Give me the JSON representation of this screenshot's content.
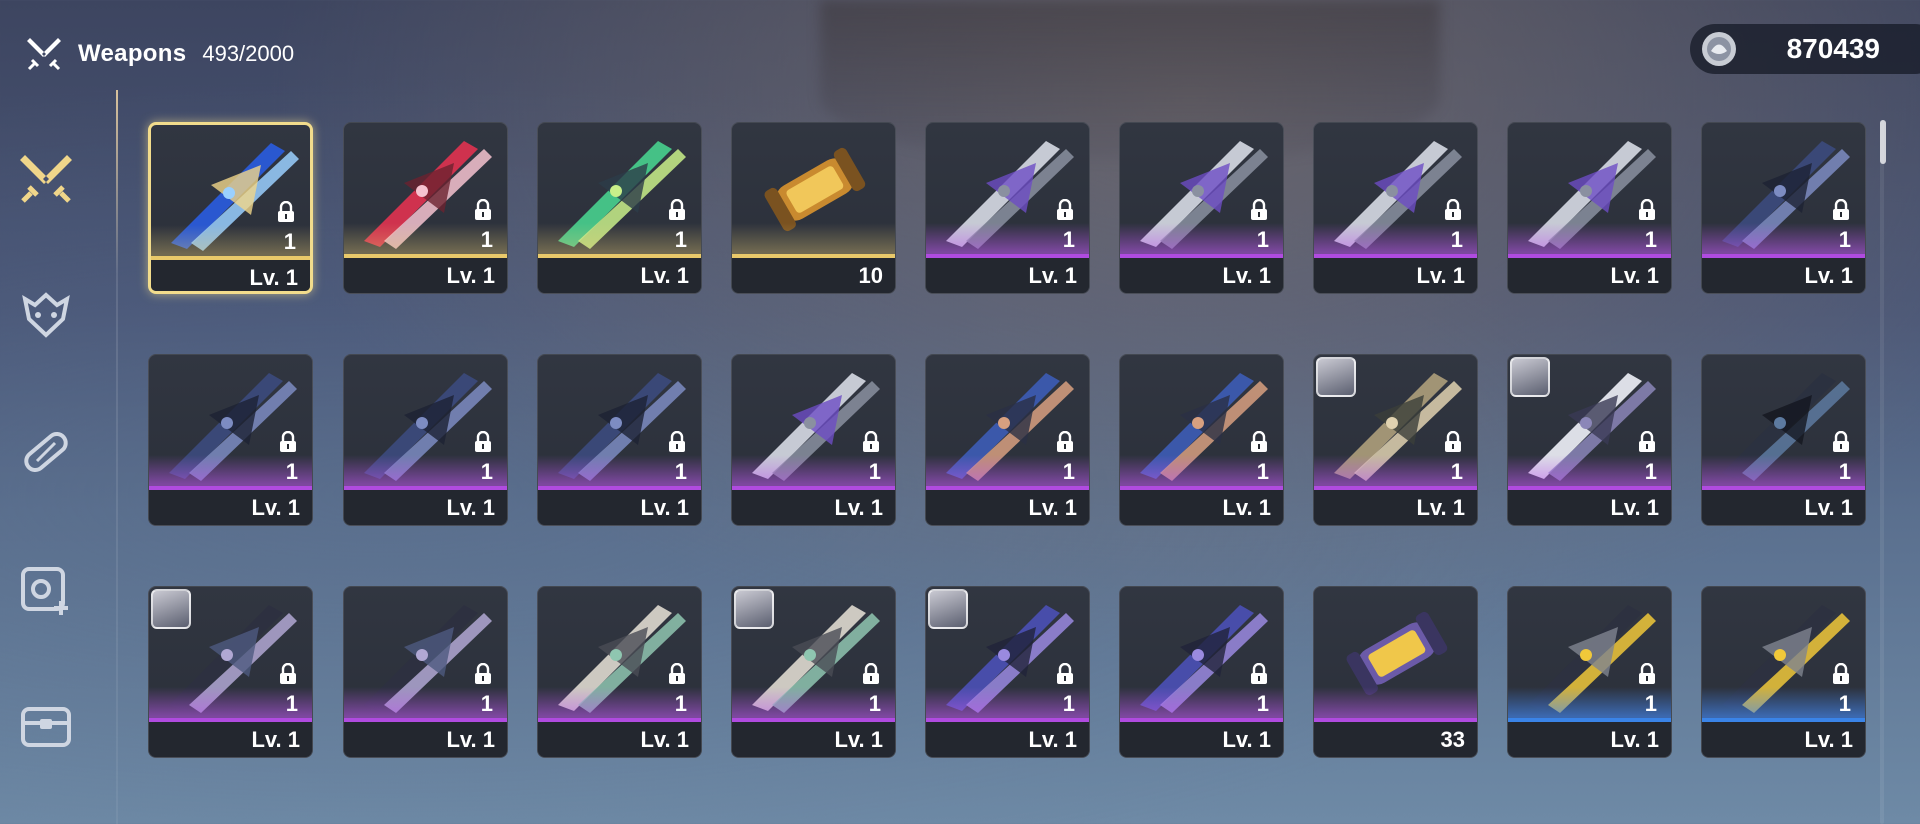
{
  "header": {
    "title": "Weapons",
    "count": "493/2000"
  },
  "currency": {
    "value": "870439",
    "icon": "shell-coin-icon"
  },
  "sidebar": [
    {
      "icon": "crossed-swords-icon",
      "active": true
    },
    {
      "icon": "echo-mask-icon",
      "active": false
    },
    {
      "icon": "capsule-icon",
      "active": false
    },
    {
      "icon": "device-plus-icon",
      "active": false
    },
    {
      "icon": "chest-icon",
      "active": false
    }
  ],
  "colors": {
    "gold": "#e9c96a",
    "purple": "#b04be0",
    "blue": "#3a84e8",
    "selected": "#f2dc8c"
  },
  "rows": [
    [
      {
        "kind": "sword-blue-orb",
        "rarity": "gold",
        "qty": "1",
        "level": "Lv. 1",
        "locked": true,
        "selected": true
      },
      {
        "kind": "sword-red",
        "rarity": "gold",
        "qty": "1",
        "level": "Lv. 1",
        "locked": true
      },
      {
        "kind": "sword-green",
        "rarity": "gold",
        "qty": "1",
        "level": "Lv. 1",
        "locked": true
      },
      {
        "kind": "tube-gold",
        "rarity": "gold",
        "qty": "10",
        "level": "",
        "locked": false
      },
      {
        "kind": "crossbow-silver",
        "rarity": "purple",
        "qty": "1",
        "level": "Lv. 1",
        "locked": true
      },
      {
        "kind": "crossbow-silver",
        "rarity": "purple",
        "qty": "1",
        "level": "Lv. 1",
        "locked": true
      },
      {
        "kind": "crossbow-silver",
        "rarity": "purple",
        "qty": "1",
        "level": "Lv. 1",
        "locked": true
      },
      {
        "kind": "crossbow-silver",
        "rarity": "purple",
        "qty": "1",
        "level": "Lv. 1",
        "locked": true
      },
      {
        "kind": "crossbow-dark",
        "rarity": "purple",
        "qty": "1",
        "level": "Lv. 1",
        "locked": true
      }
    ],
    [
      {
        "kind": "crossbow-dark",
        "rarity": "purple",
        "qty": "1",
        "level": "Lv. 1",
        "locked": true
      },
      {
        "kind": "crossbow-dark",
        "rarity": "purple",
        "qty": "1",
        "level": "Lv. 1",
        "locked": true
      },
      {
        "kind": "crossbow-dark",
        "rarity": "purple",
        "qty": "1",
        "level": "Lv. 1",
        "locked": true
      },
      {
        "kind": "crossbow-silver",
        "rarity": "purple",
        "qty": "1",
        "level": "Lv. 1",
        "locked": true
      },
      {
        "kind": "gauntlet-blue",
        "rarity": "purple",
        "qty": "1",
        "level": "Lv. 1",
        "locked": true
      },
      {
        "kind": "gauntlet-blue",
        "rarity": "purple",
        "qty": "1",
        "level": "Lv. 1",
        "locked": true
      },
      {
        "kind": "gauntlet-pair",
        "rarity": "purple",
        "qty": "1",
        "level": "Lv. 1",
        "locked": true,
        "avatar": true
      },
      {
        "kind": "pistol-silver",
        "rarity": "purple",
        "qty": "1",
        "level": "Lv. 1",
        "locked": true,
        "avatar": true
      },
      {
        "kind": "pistol-dark",
        "rarity": "purple",
        "qty": "1",
        "level": "Lv. 1",
        "locked": true
      }
    ],
    [
      {
        "kind": "blade-dark",
        "rarity": "purple",
        "qty": "1",
        "level": "Lv. 1",
        "locked": true,
        "avatar": true
      },
      {
        "kind": "blade-dark",
        "rarity": "purple",
        "qty": "1",
        "level": "Lv. 1",
        "locked": true
      },
      {
        "kind": "sword-pale",
        "rarity": "purple",
        "qty": "1",
        "level": "Lv. 1",
        "locked": true
      },
      {
        "kind": "sword-pale",
        "rarity": "purple",
        "qty": "1",
        "level": "Lv. 1",
        "locked": true,
        "avatar": true
      },
      {
        "kind": "broadsword-blue",
        "rarity": "purple",
        "qty": "1",
        "level": "Lv. 1",
        "locked": true,
        "avatar": true
      },
      {
        "kind": "broadsword-blue",
        "rarity": "purple",
        "qty": "1",
        "level": "Lv. 1",
        "locked": true
      },
      {
        "kind": "tube-purple",
        "rarity": "purple",
        "qty": "33",
        "level": "",
        "locked": false
      },
      {
        "kind": "crossbow-gold",
        "rarity": "blue",
        "qty": "1",
        "level": "Lv. 1",
        "locked": true
      },
      {
        "kind": "crossbow-gold",
        "rarity": "blue",
        "qty": "1",
        "level": "Lv. 1",
        "locked": true
      }
    ]
  ]
}
